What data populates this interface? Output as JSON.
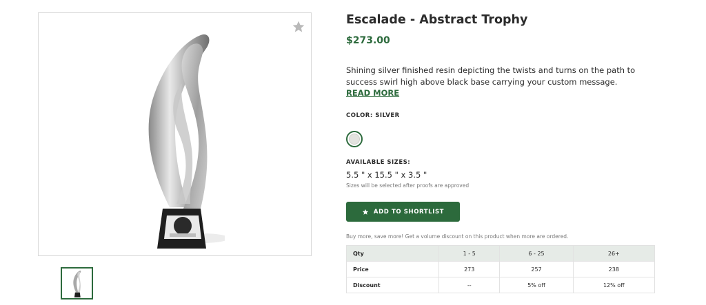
{
  "product": {
    "title": "Escalade - Abstract Trophy",
    "price": "$273.00",
    "description": "Shining silver finished resin depicting the twists and turns on the path to success swirl high above black base carrying your custom message.",
    "read_more_label": "READ MORE",
    "color_label": "COLOR: SILVER",
    "colors": [
      {
        "name": "Silver",
        "hex": "#e3e3df",
        "selected": true
      }
    ],
    "sizes_label": "AVAILABLE SIZES:",
    "size_value": "5.5 \" x 15.5 \" x 3.5 \"",
    "size_note": "Sizes will be selected after proofs are approved",
    "shortlist_label": "ADD TO SHORTLIST",
    "volume_note": "Buy more, save more! Get a volume discount on this product when more are ordered."
  },
  "gallery": {
    "main_image_icon": "trophy-image",
    "favorite_icon": "star-icon",
    "thumbnail_icon": "trophy-thumbnail"
  },
  "pricing_table": {
    "header": [
      "Qty",
      "1 - 5",
      "6 - 25",
      "26+"
    ],
    "rows": [
      [
        "Price",
        "273",
        "257",
        "238"
      ],
      [
        "Discount",
        "--",
        "5% off",
        "12% off"
      ]
    ]
  },
  "colors": {
    "accent": "#2c6a3c",
    "table_header_bg": "#e6ebe7"
  }
}
